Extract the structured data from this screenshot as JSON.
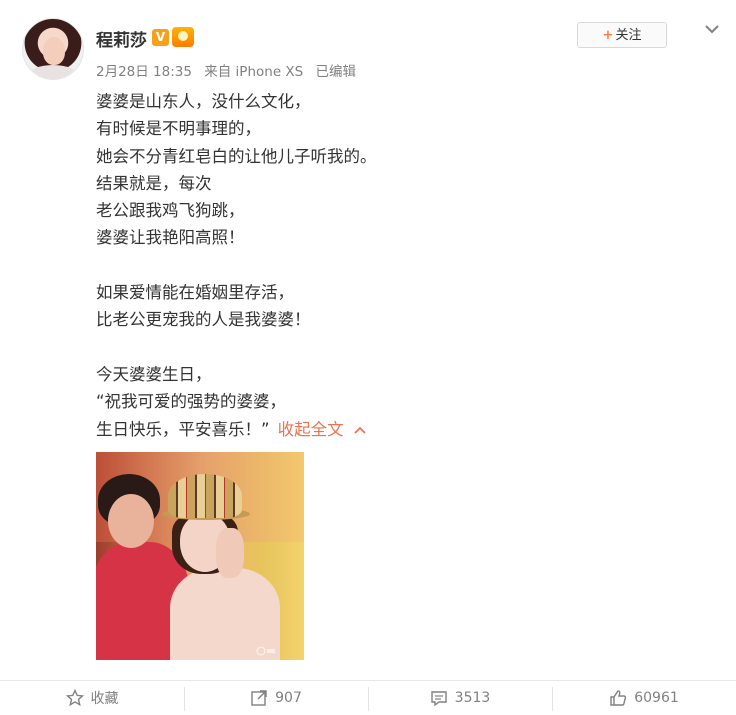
{
  "user": {
    "name": "程莉莎",
    "verified_badge": "V"
  },
  "post": {
    "date": "2月28日 18:35",
    "source": "来自 iPhone XS",
    "edited": "已编辑",
    "lines": [
      "婆婆是山东人，没什么文化，",
      "有时候是不明事理的，",
      "她会不分青红皂白的让他儿子听我的。",
      "结果就是，每次",
      "老公跟我鸡飞狗跳，",
      "婆婆让我艳阳高照！",
      "",
      "如果爱情能在婚姻里存活，",
      "比老公更宠我的人是我婆婆！",
      "",
      "今天婆婆生日，",
      "“祝我可爱的强势的婆婆，",
      "生日快乐，平安喜乐！”"
    ],
    "collapse_label": "收起全文"
  },
  "follow_button": {
    "plus": "+",
    "label": "关注"
  },
  "actions": {
    "favorite": "收藏",
    "repost": "907",
    "comment": "3513",
    "like": "60961"
  },
  "colors": {
    "accent": "#eb7350",
    "follow_plus": "#ff8140",
    "muted": "#808080",
    "text": "#333333"
  }
}
